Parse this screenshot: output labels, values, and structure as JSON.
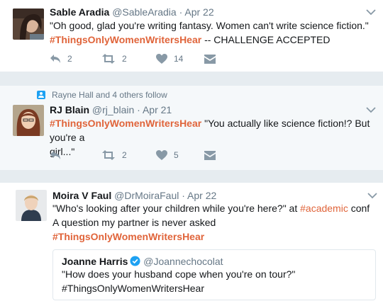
{
  "tweets": [
    {
      "name": "Sable Aradia",
      "handle": "@SableAradia",
      "date": "Apr 22",
      "line1": "\"Oh good, glad you're writing fantasy. Women can't write science fiction.\"",
      "hashtag": "#ThingsOnlyWomenWritersHear",
      "suffix": " -- CHALLENGE ACCEPTED",
      "reply_count": "2",
      "retweet_count": "2",
      "like_count": "14"
    },
    {
      "context": "Rayne Hall and 4 others follow",
      "name": "RJ Blain",
      "handle": "@rj_blain",
      "date": "Apr 21",
      "hashtag": "#ThingsOnlyWomenWritersHear",
      "text_rest": " \"You actually like science fiction!? But you're a",
      "line2": "girl...\"",
      "retweet_count": "2",
      "like_count": "5"
    },
    {
      "name": "Moira V Faul",
      "handle": "@DrMoiraFaul",
      "date": "Apr 22",
      "line1_a": "\"Who's looking after your children while you're here?\" at ",
      "line1_tag": "#academic",
      "line1_b": " conf",
      "line2": "A question my partner is never asked",
      "hashtag": "#ThingsOnlyWomenWritersHear",
      "quote": {
        "name": "Joanne Harris",
        "handle": "@Joannechocolat",
        "line1": "\"How does your husband cope when you're on tour?\"",
        "line2": "#ThingsOnlyWomenWritersHear"
      }
    }
  ],
  "separator": "·",
  "colors": {
    "hashtag": "#e0643a",
    "icon": "#8899a6",
    "verified": "#1da1f2"
  }
}
